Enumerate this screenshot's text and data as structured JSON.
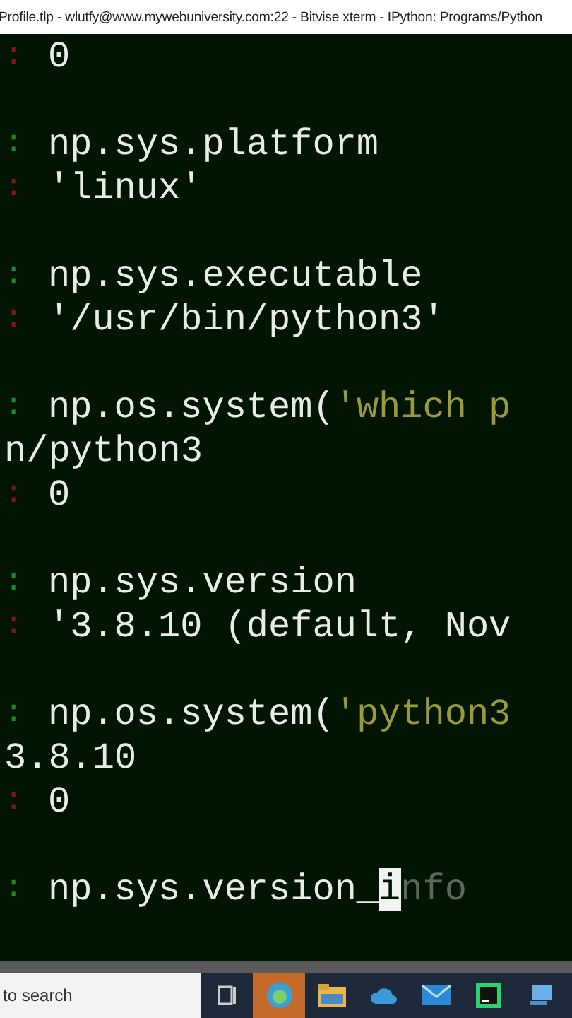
{
  "window": {
    "title": "Profile.tlp - wlutfy@www.mywebuniversity.com:22 - Bitvise xterm - IPython: Programs/Python"
  },
  "terminal": {
    "lines": [
      {
        "kind": "out",
        "prompt": ":",
        "segments": [
          {
            "kind": "code",
            "text": "0"
          }
        ]
      },
      {
        "kind": "blank"
      },
      {
        "kind": "in",
        "prompt": ":",
        "segments": [
          {
            "kind": "code",
            "text": "np.sys.platform"
          }
        ]
      },
      {
        "kind": "out",
        "prompt": ":",
        "segments": [
          {
            "kind": "code",
            "text": "'linux'"
          }
        ]
      },
      {
        "kind": "blank"
      },
      {
        "kind": "in",
        "prompt": ":",
        "segments": [
          {
            "kind": "code",
            "text": "np.sys.executable"
          }
        ]
      },
      {
        "kind": "out",
        "prompt": ":",
        "segments": [
          {
            "kind": "code",
            "text": "'/usr/bin/python3'"
          }
        ]
      },
      {
        "kind": "blank"
      },
      {
        "kind": "in",
        "prompt": ":",
        "segments": [
          {
            "kind": "code",
            "text": "np.os.system("
          },
          {
            "kind": "string",
            "text": "'which p"
          }
        ]
      },
      {
        "kind": "plain",
        "segments": [
          {
            "kind": "code",
            "text": "n/python3"
          }
        ]
      },
      {
        "kind": "out",
        "prompt": ":",
        "segments": [
          {
            "kind": "code",
            "text": "0"
          }
        ]
      },
      {
        "kind": "blank"
      },
      {
        "kind": "in",
        "prompt": ":",
        "segments": [
          {
            "kind": "code",
            "text": "np.sys.version"
          }
        ]
      },
      {
        "kind": "out",
        "prompt": ":",
        "segments": [
          {
            "kind": "code",
            "text": "'3.8.10 (default, Nov"
          }
        ]
      },
      {
        "kind": "blank"
      },
      {
        "kind": "in",
        "prompt": ":",
        "segments": [
          {
            "kind": "code",
            "text": "np.os.system("
          },
          {
            "kind": "string",
            "text": "'python3"
          }
        ]
      },
      {
        "kind": "plain",
        "segments": [
          {
            "kind": "code",
            "text": "3.8.10"
          }
        ]
      },
      {
        "kind": "out",
        "prompt": ":",
        "segments": [
          {
            "kind": "code",
            "text": "0"
          }
        ]
      },
      {
        "kind": "blank"
      },
      {
        "kind": "in",
        "prompt": ":",
        "segments": [
          {
            "kind": "code",
            "text": "np.sys.version_"
          },
          {
            "kind": "cursor",
            "text": "i"
          },
          {
            "kind": "hint",
            "text": "nfo"
          }
        ]
      }
    ]
  },
  "taskbar": {
    "search": {
      "placeholder": "to search"
    }
  }
}
